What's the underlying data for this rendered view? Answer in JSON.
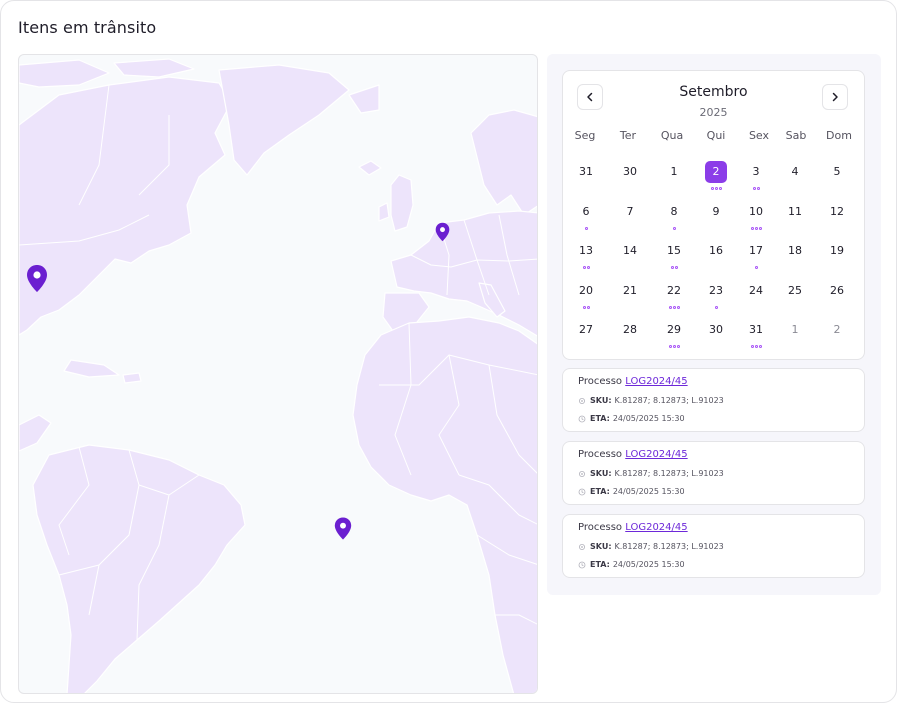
{
  "page": {
    "title": "Itens em trânsito"
  },
  "map": {
    "pins": [
      {
        "name": "north-america"
      },
      {
        "name": "europe"
      },
      {
        "name": "south-atlantic"
      }
    ]
  },
  "calendar": {
    "month": "Setembro",
    "year": "2025",
    "weekdays": [
      "Seg",
      "Ter",
      "Qua",
      "Qui",
      "Sex",
      "Sab",
      "Dom"
    ],
    "weeks": [
      [
        {
          "d": "31",
          "muted": false,
          "dots": 0
        },
        {
          "d": "30",
          "muted": false,
          "dots": 0
        },
        {
          "d": "1",
          "dots": 0
        },
        {
          "d": "2",
          "selected": true,
          "dots": 3
        },
        {
          "d": "3",
          "dots": 2
        },
        {
          "d": "4",
          "dots": 0
        },
        {
          "d": "5",
          "dots": 0
        }
      ],
      [
        {
          "d": "6",
          "dots": 1
        },
        {
          "d": "7",
          "dots": 0
        },
        {
          "d": "8",
          "dots": 1
        },
        {
          "d": "9",
          "dots": 0
        },
        {
          "d": "10",
          "dots": 3
        },
        {
          "d": "11",
          "dots": 0
        },
        {
          "d": "12",
          "dots": 0
        }
      ],
      [
        {
          "d": "13",
          "dots": 2
        },
        {
          "d": "14",
          "dots": 0
        },
        {
          "d": "15",
          "dots": 2
        },
        {
          "d": "16",
          "dots": 0
        },
        {
          "d": "17",
          "dots": 1
        },
        {
          "d": "18",
          "dots": 0
        },
        {
          "d": "19",
          "dots": 0
        }
      ],
      [
        {
          "d": "20",
          "dots": 2
        },
        {
          "d": "21",
          "dots": 0
        },
        {
          "d": "22",
          "dots": 3
        },
        {
          "d": "23",
          "dots": 1
        },
        {
          "d": "24",
          "dots": 0
        },
        {
          "d": "25",
          "dots": 0
        },
        {
          "d": "26",
          "dots": 0
        }
      ],
      [
        {
          "d": "27",
          "dots": 0
        },
        {
          "d": "28",
          "dots": 0
        },
        {
          "d": "29",
          "dots": 3
        },
        {
          "d": "30",
          "dots": 0
        },
        {
          "d": "31",
          "dots": 3
        },
        {
          "d": "1",
          "muted": true,
          "dots": 0
        },
        {
          "d": "2",
          "muted": true,
          "dots": 0
        }
      ]
    ],
    "prev_icon": "chevron-left-icon",
    "next_icon": "chevron-right-icon"
  },
  "processes": [
    {
      "label": "Processo",
      "code": "LOG2024/45",
      "sku_label": "SKU:",
      "sku": "K.81287; 8.12873; L.91023",
      "eta_label": "ETA:",
      "eta": "24/05/2025 15:30"
    },
    {
      "label": "Processo",
      "code": "LOG2024/45",
      "sku_label": "SKU:",
      "sku": "K.81287; 8.12873; L.91023",
      "eta_label": "ETA:",
      "eta": "24/05/2025 15:30"
    },
    {
      "label": "Processo",
      "code": "LOG2024/45",
      "sku_label": "SKU:",
      "sku": "K.81287; 8.12873; L.91023",
      "eta_label": "ETA:",
      "eta": "24/05/2025 15:30"
    }
  ],
  "colors": {
    "accent": "#8b3de8",
    "pin": "#6b1fd0",
    "land": "#ede4fb",
    "border_line": "#ffffff"
  }
}
